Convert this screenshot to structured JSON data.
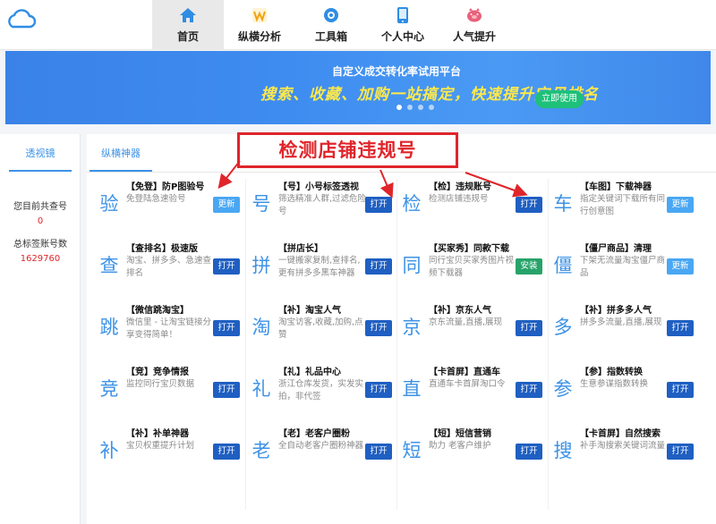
{
  "app": {
    "logo_icon": "cloud-icon"
  },
  "nav": {
    "items": [
      {
        "label": "首页",
        "icon": "home-icon",
        "active": true
      },
      {
        "label": "纵横分析",
        "icon": "chart-w-icon"
      },
      {
        "label": "工具箱",
        "icon": "toolbox-icon"
      },
      {
        "label": "个人中心",
        "icon": "phone-user-icon"
      },
      {
        "label": "人气提升",
        "icon": "pig-icon"
      }
    ]
  },
  "banner": {
    "line1": "自定义成交转化率试用平台",
    "line2": "搜索、收藏、加购一站搞定，快速提升宝贝排名",
    "button": "立即使用"
  },
  "sidebar": {
    "tab": "透视镜",
    "query_label": "您目前共查号",
    "query_count": "0",
    "total_label": "总标签账号数",
    "total_count": "1629760"
  },
  "main": {
    "tab": "纵横神器",
    "callout": "检测店铺违规号",
    "cards": [
      {
        "big": "验",
        "title": "【免登】防P图验号",
        "desc": "免登陆急速验号",
        "button": "更新",
        "btn_type": "update"
      },
      {
        "big": "号",
        "title": "【号】小号标签透视",
        "desc": "筛选精准人群,过滤危险号",
        "button": "打开",
        "btn_type": "open"
      },
      {
        "big": "检",
        "title": "【检】违规账号",
        "desc": "检测店铺违规号",
        "button": "打开",
        "btn_type": "open"
      },
      {
        "big": "车",
        "title": "【车图】下载神器",
        "desc": "指定关键词下载所有同行创意图",
        "button": "更新",
        "btn_type": "update"
      },
      {
        "big": "查",
        "title": "【查排名】极速版",
        "desc": "淘宝、拼多多、急速查排名",
        "button": "打开",
        "btn_type": "open"
      },
      {
        "big": "拼",
        "title": "【拼店长】",
        "desc": "一键搬家复制,查排名,更有拼多多黑车神器",
        "button": "打开",
        "btn_type": "open"
      },
      {
        "big": "同",
        "title": "【买家秀】同款下载",
        "desc": "同行宝贝买家秀图片视频下载器",
        "button": "安装",
        "btn_type": "install"
      },
      {
        "big": "僵",
        "title": "【僵尸商品】清理",
        "desc": "下架无流量淘宝僵尸商品",
        "button": "更新",
        "btn_type": "update"
      },
      {
        "big": "跳",
        "title": "【微信跳淘宝】",
        "desc": "微信里 - 让淘宝链接分享变得简单！",
        "button": "打开",
        "btn_type": "open"
      },
      {
        "big": "淘",
        "title": "【补】淘宝人气",
        "desc": "淘宝访客,收藏,加购,点赞",
        "button": "打开",
        "btn_type": "open"
      },
      {
        "big": "京",
        "title": "【补】京东人气",
        "desc": "京东流量,直播,展现",
        "button": "打开",
        "btn_type": "open"
      },
      {
        "big": "多",
        "title": "【补】拼多多人气",
        "desc": "拼多多流量,直播,展现",
        "button": "打开",
        "btn_type": "open"
      },
      {
        "big": "竞",
        "title": "【竞】竞争情报",
        "desc": "监控同行宝贝数据",
        "button": "打开",
        "btn_type": "open"
      },
      {
        "big": "礼",
        "title": "【礼】礼品中心",
        "desc": "浙江仓库发货，实发实拍，非代签",
        "button": "打开",
        "btn_type": "open"
      },
      {
        "big": "直",
        "title": "【卡首屏】直通车",
        "desc": "直通车卡首屏淘口令",
        "button": "打开",
        "btn_type": "open"
      },
      {
        "big": "参",
        "title": "【参】指数转换",
        "desc": "生意参谋指数转换",
        "button": "打开",
        "btn_type": "open"
      },
      {
        "big": "补",
        "title": "【补】补单神器",
        "desc": "宝贝权重提升计划",
        "button": "打开",
        "btn_type": "open"
      },
      {
        "big": "老",
        "title": "【老】老客户圈粉",
        "desc": "全自动老客户圈粉神器",
        "button": "打开",
        "btn_type": "open"
      },
      {
        "big": "短",
        "title": "【短】短信营销",
        "desc": "助力 老客户维护",
        "button": "打开",
        "btn_type": "open"
      },
      {
        "big": "搜",
        "title": "【卡首屏】自然搜索",
        "desc": "补手淘搜索关键词流量",
        "button": "打开",
        "btn_type": "open"
      }
    ]
  }
}
